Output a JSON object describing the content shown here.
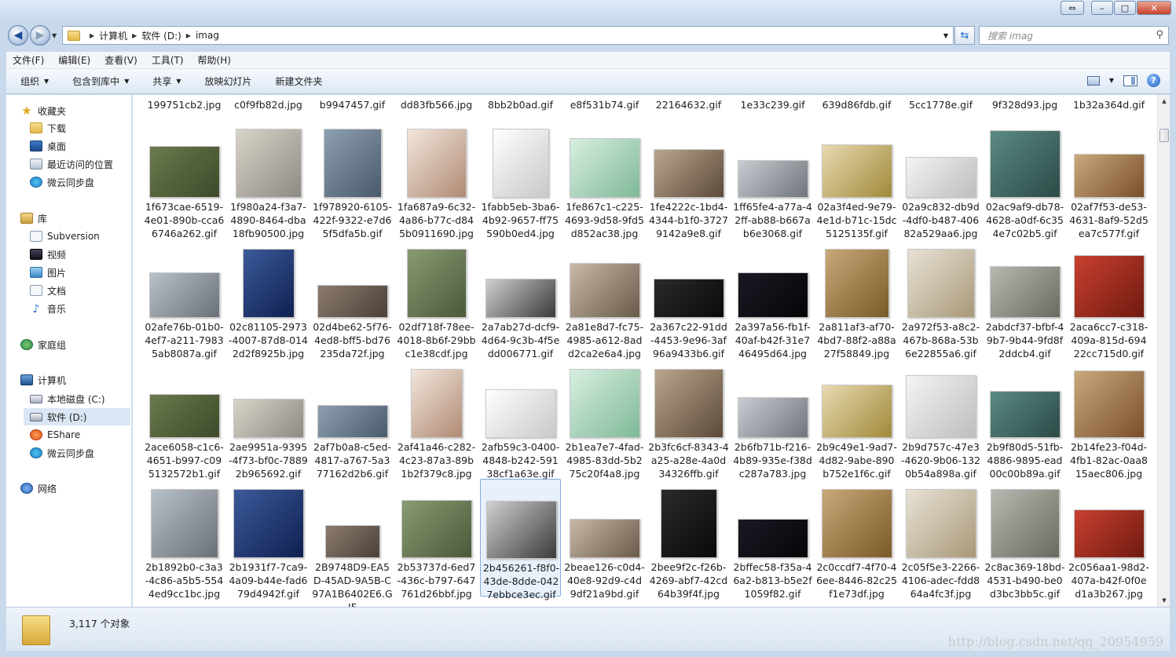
{
  "window": {
    "restore_icon": "⇔",
    "min_icon": "–",
    "max_icon": "□",
    "close_icon": "✕"
  },
  "address": {
    "crumbs": [
      "计算机",
      "软件 (D:)",
      "imag"
    ],
    "search_placeholder": "搜索 imag"
  },
  "menu": [
    "文件(F)",
    "编辑(E)",
    "查看(V)",
    "工具(T)",
    "帮助(H)"
  ],
  "toolbar": [
    "组织",
    "包含到库中",
    "共享",
    "放映幻灯片",
    "新建文件夹"
  ],
  "nav": {
    "favorites": "收藏夹",
    "downloads": "下载",
    "desktop": "桌面",
    "recent": "最近访问的位置",
    "cloud1": "微云同步盘",
    "libraries": "库",
    "subversion": "Subversion",
    "videos": "视频",
    "pictures": "图片",
    "documents": "文档",
    "music": "音乐",
    "homegroup": "家庭组",
    "computer": "计算机",
    "local_c": "本地磁盘 (C:)",
    "soft_d": "软件 (D:)",
    "eshare": "EShare",
    "cloud2": "微云同步盘",
    "network": "网络"
  },
  "partial_row": [
    "199751cb2.jpg",
    "c0f9fb82d.jpg",
    "b9947457.gif",
    "dd83fb566.jpg",
    "8bb2b0ad.gif",
    "e8f531b74.gif",
    "22164632.gif",
    "1e33c239.gif",
    "639d86fdb.gif",
    "5cc1778e.gif",
    "9f328d93.jpg",
    "1b32a364d.gif"
  ],
  "files": [
    [
      "1f673cae-6519-4e01-890b-cca66746a262.gif",
      "1f980a24-f3a7-4890-8464-dba18fb90500.jpg",
      "1f978920-6105-422f-9322-e7d65f5dfa5b.gif",
      "1fa687a9-6c32-4a86-b77c-d845b0911690.jpg",
      "1fabb5eb-3ba6-4b92-9657-ff75590b0ed4.jpg",
      "1fe867c1-c225-4693-9d58-9fd5d852ac38.jpg",
      "1fe4222c-1bd4-4344-b1f0-37279142a9e8.gif",
      "1ff65fe4-a77a-42ff-ab88-b667ab6e3068.gif",
      "02a3f4ed-9e79-4e1d-b71c-15dc5125135f.gif",
      "02a9c832-db9d-4df0-b487-40682a529aa6.jpg",
      "02ac9af9-db78-4628-a0df-6c354e7c02b5.gif",
      "02af7f53-de53-4631-8af9-52d5ea7c577f.gif"
    ],
    [
      "02afe76b-01b0-4ef7-a211-79835ab8087a.gif",
      "02c81105-2973-4007-87d8-0142d2f8925b.jpg",
      "02d4be62-5f76-4ed8-bff5-bd76235da72f.jpg",
      "02df718f-78ee-4018-8b6f-29bbc1e38cdf.jpg",
      "2a7ab27d-dcf9-4d64-9c3b-4f5edd006771.gif",
      "2a81e8d7-fc75-4985-a612-8add2ca2e6a4.jpg",
      "2a367c22-91dd-4453-9e96-3af96a9433b6.gif",
      "2a397a56-fb1f-40af-b42f-31e746495d64.jpg",
      "2a811af3-af70-4bd7-88f2-a88a27f58849.jpg",
      "2a972f53-a8c2-467b-868a-53b6e22855a6.gif",
      "2abdcf37-bfbf-49b7-9b44-9fd8f2ddcb4.gif",
      "2aca6cc7-c318-409a-815d-69422cc715d0.gif"
    ],
    [
      "2ace6058-c1c6-4651-b997-c095132572b1.gif",
      "2ae9951a-9395-4f73-bf0c-78892b965692.gif",
      "2af7b0a8-c5ed-4817-a767-5a377162d2b6.gif",
      "2af41a46-c282-4c23-87a3-89b1b2f379c8.jpg",
      "2afb59c3-0400-4848-b242-59138cf1a63e.gif",
      "2b1ea7e7-4fad-4985-83dd-5b275c20f4a8.jpg",
      "2b3fc6cf-8343-4a25-a28e-4a0d34326ffb.gif",
      "2b6fb71b-f216-4b89-935e-f38dc287a783.jpg",
      "2b9c49e1-9ad7-4d82-9abe-890b752e1f6c.gif",
      "2b9d757c-47e3-4620-9b06-1320b54a898a.gif",
      "2b9f80d5-51fb-4886-9895-ead00c00b89a.gif",
      "2b14fe23-f04d-4fb1-82ac-0aa815aec806.jpg"
    ],
    [
      "2b1892b0-c3a3-4c86-a5b5-5544ed9cc1bc.jpg",
      "2b1931f7-7ca9-4a09-b44e-fad679d4942f.gif",
      "2B9748D9-EA5D-45AD-9A5B-C97A1B6402E6.GIF",
      "2b53737d-6ed7-436c-b797-647761d26bbf.jpg",
      "2b456261-f8f0-43de-8dde-0427ebbce3ec.gif",
      "2beae126-c0d4-40e8-92d9-c4d9df21a9bd.gif",
      "2bee9f2c-f26b-4269-abf7-42cd64b39f4f.jpg",
      "2bffec58-f35a-46a2-b813-b5e2f1059f82.gif",
      "2c0ccdf7-4f70-46ee-8446-82c25f1e73df.jpg",
      "2c05f5e3-2266-4106-adec-fdd864a4fc3f.jpg",
      "2c8ac369-18bd-4531-b490-be0d3bc3bb5c.gif",
      "2c056aa1-98d2-407a-b42f-0f0ed1a3b267.jpg"
    ]
  ],
  "status": {
    "count": "3,117 个对象",
    "watermark": "http://blog.csdn.net/qq_20954959"
  }
}
